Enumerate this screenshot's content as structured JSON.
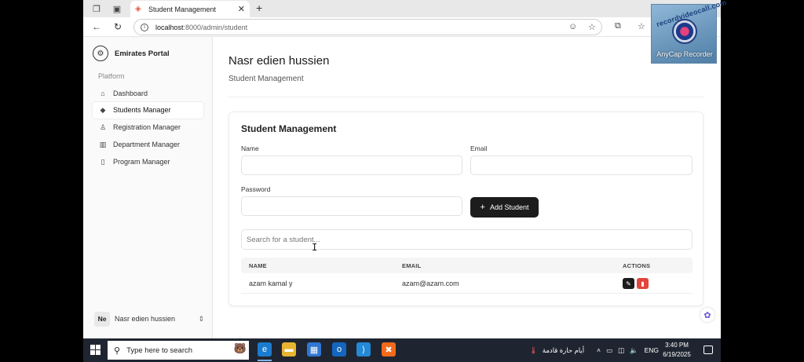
{
  "browser": {
    "tab_title": "Student Management",
    "new_tab_symbol": "+",
    "url_host": "localhost",
    "url_path": ":8000/admin/student"
  },
  "sidebar": {
    "brand": "Emirates Portal",
    "section_label": "Platform",
    "items": [
      {
        "label": "Dashboard",
        "icon": "home-icon",
        "active": false
      },
      {
        "label": "Students Manager",
        "icon": "graduation-cap-icon",
        "active": true
      },
      {
        "label": "Registration Manager",
        "icon": "user-icon",
        "active": false
      },
      {
        "label": "Department Manager",
        "icon": "building-icon",
        "active": false
      },
      {
        "label": "Program Manager",
        "icon": "book-icon",
        "active": false
      }
    ],
    "user": {
      "initials": "Ne",
      "name": "Nasr edien hussien"
    }
  },
  "main": {
    "title": "Nasr edien hussien",
    "subtitle": "Student Management",
    "card_title": "Student Management",
    "form": {
      "name_label": "Name",
      "email_label": "Email",
      "password_label": "Password",
      "name_value": "",
      "email_value": "",
      "password_value": "",
      "add_button": "Add Student"
    },
    "search_placeholder": "Search for a student...",
    "table": {
      "headers": [
        "NAME",
        "EMAIL",
        "ACTIONS"
      ],
      "rows": [
        {
          "name": "azam kamal y",
          "email": "azam@azam.com"
        }
      ]
    }
  },
  "taskbar": {
    "search_text": "Type here to search",
    "weather_text": "أيام حارة قادمة",
    "language": "ENG",
    "time": "3:40 PM",
    "date": "6/19/2025"
  },
  "watermark": {
    "arc_text": "recordvideocall.com",
    "label": "AnyCap Recorder"
  },
  "colors": {
    "primary_button": "#1c1c1c",
    "delete_button": "#e2463c",
    "taskbar": "#1f2530"
  }
}
